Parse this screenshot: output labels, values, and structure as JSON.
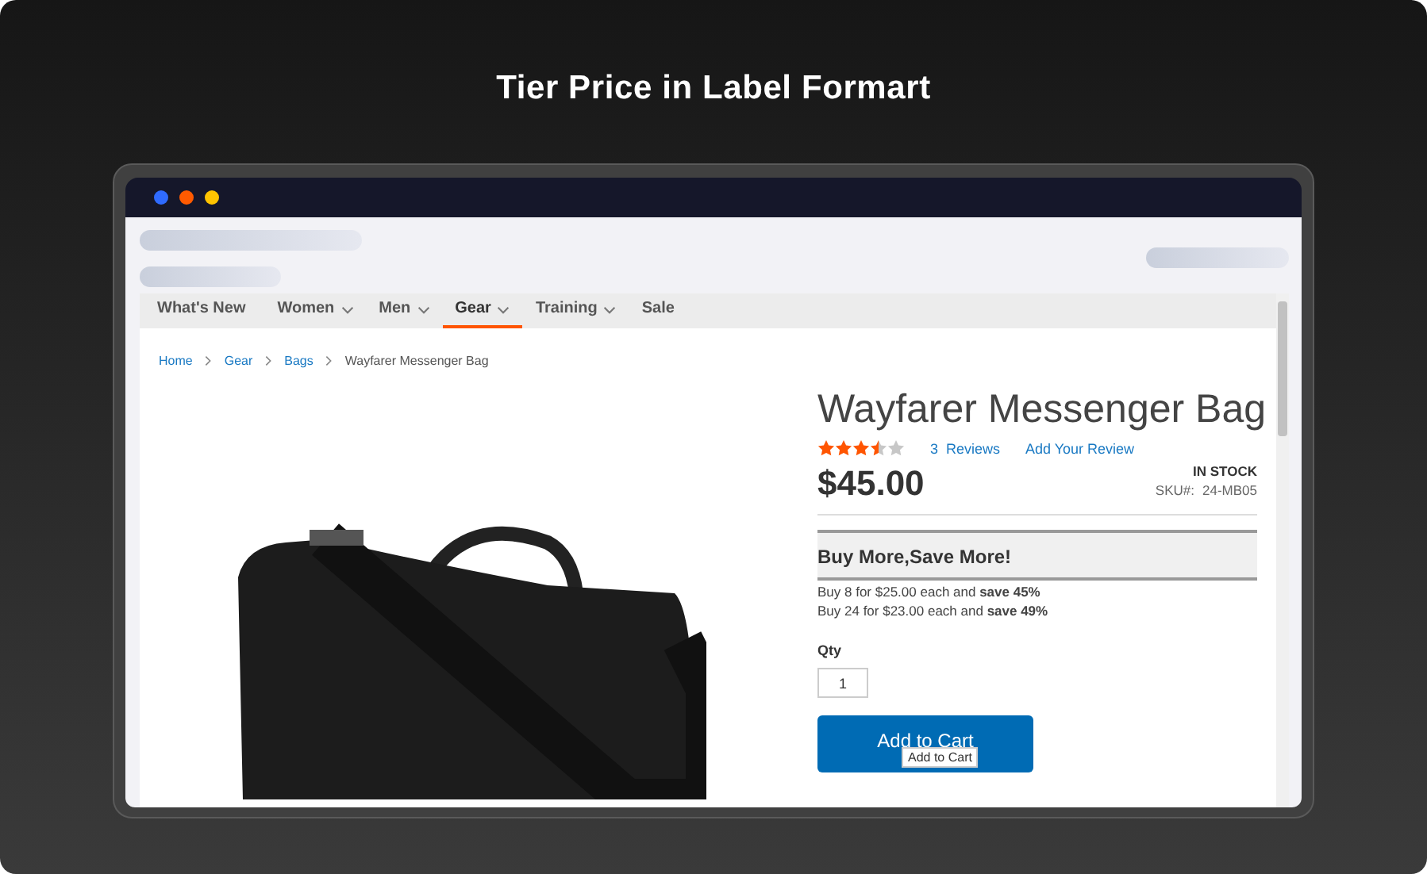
{
  "title": "Tier Price in Label Formart",
  "nav": [
    {
      "label": "What's New",
      "dropdown": false,
      "selected": false
    },
    {
      "label": "Women",
      "dropdown": true,
      "selected": false
    },
    {
      "label": "Men",
      "dropdown": true,
      "selected": false
    },
    {
      "label": "Gear",
      "dropdown": true,
      "selected": true
    },
    {
      "label": "Training",
      "dropdown": true,
      "selected": false
    },
    {
      "label": "Sale",
      "dropdown": false,
      "selected": false
    }
  ],
  "breadcrumbs": [
    {
      "label": "Home",
      "link": true
    },
    {
      "label": "Gear",
      "link": true
    },
    {
      "label": "Bags",
      "link": true
    },
    {
      "label": "Wayfarer Messenger Bag",
      "link": false
    }
  ],
  "product": {
    "name": "Wayfarer Messenger Bag",
    "stars": 3.5,
    "review_count": "3",
    "reviews_label": "Reviews",
    "add_review": "Add Your Review",
    "price": "$45.00",
    "stock": "IN STOCK",
    "sku_label": "SKU#:",
    "sku": "24-MB05"
  },
  "tier": {
    "heading": "Buy More,Save More!",
    "lines": [
      "Buy 8 for $25.00 each and **save 45%**",
      "Buy 24 for $23.00 each and **save 49%**"
    ]
  },
  "qty": {
    "label": "Qty",
    "value": "1"
  },
  "cart_button": "Add to Cart",
  "tooltip": "Add to Cart"
}
